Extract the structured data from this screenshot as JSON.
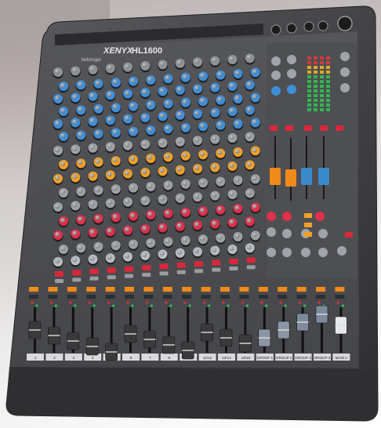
{
  "product": {
    "brand": "behringer",
    "logo_text": "XENYX",
    "model": "HL1600"
  },
  "strip_labels": [
    "1",
    "2",
    "3",
    "4",
    "5",
    "6",
    "7",
    "8",
    "9/10",
    "11/12",
    "13/14",
    "15/16",
    "GROUP 1",
    "GROUP 2",
    "GROUP 3",
    "GROUP 4",
    "MAIN A"
  ],
  "colors": {
    "chassis": "#3c3c3e",
    "panel": "#4a4a4d",
    "knob_blue": "#3f8fd8",
    "knob_orange": "#f0a028",
    "knob_red": "#e0304a",
    "button_red": "#d8283a",
    "fader_orange": "#f08a1a",
    "fader_blue": "#3a8acb",
    "fader_grey": "#8a96a6",
    "fader_white": "#e6e8ea"
  }
}
